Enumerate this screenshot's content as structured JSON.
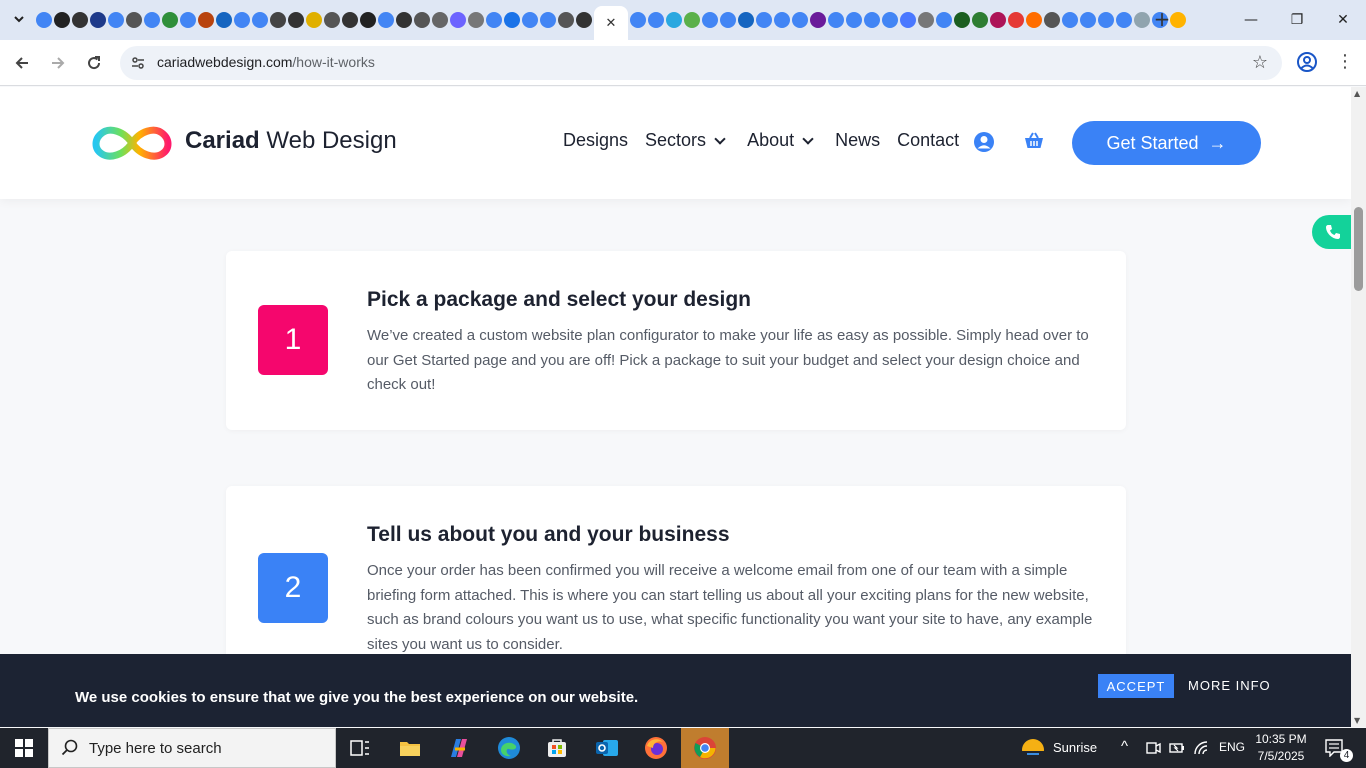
{
  "browser": {
    "active_tab_close": "✕",
    "new_tab": "+",
    "url_domain": "cariadwebdesign.com",
    "url_path": "/how-it-works",
    "window_controls": {
      "minimize": "—",
      "restore": "❐",
      "close": "✕"
    }
  },
  "site": {
    "logo_bold": "Cariad",
    "logo_rest": " Web Design",
    "nav": [
      {
        "label": "Designs",
        "dropdown": false
      },
      {
        "label": "Sectors",
        "dropdown": true
      },
      {
        "label": "About",
        "dropdown": true
      },
      {
        "label": "News",
        "dropdown": false
      },
      {
        "label": "Contact",
        "dropdown": false
      }
    ],
    "cta_label": "Get Started",
    "cta_arrow": "→"
  },
  "steps": [
    {
      "number": "1",
      "color": "#f5066d",
      "title": "Pick a package and select your design",
      "body": "We’ve created a custom website plan configurator to make your life as easy as possible. Simply head over to our Get Started page and you are off! Pick a package to suit your budget and select your design choice and check out!"
    },
    {
      "number": "2",
      "color": "#3a82f6",
      "title": "Tell us about you and your business",
      "body": "Once your order has been confirmed you will receive a welcome email from one of our team with a simple briefing form attached. This is where you can start telling us about all your exciting plans for the new website, such as brand colours you want us to use, what specific functionality you want your site to have, any example sites you want us to consider."
    }
  ],
  "cookie": {
    "text": "We use cookies to ensure that we give you the best experience on our website.",
    "accept": "ACCEPT",
    "more": "MORE INFO"
  },
  "taskbar": {
    "search_placeholder": "Type here to search",
    "weather": "Sunrise",
    "language": "ENG",
    "time": "10:35 PM",
    "date": "7/5/2025",
    "notification_count": "4"
  },
  "colors": {
    "accent": "#3a82f6",
    "step1": "#f5066d",
    "phone": "#13d29a",
    "cookie_bg": "#1c2333"
  }
}
